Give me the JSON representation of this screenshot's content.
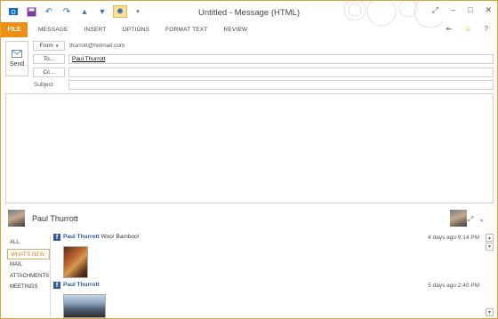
{
  "window": {
    "title": "Untitled - Message (HTML)"
  },
  "qat": {
    "icons": [
      "outlook-icon",
      "save-icon",
      "undo-icon",
      "redo-icon",
      "previous-icon",
      "next-icon",
      "touch-mode-icon",
      "customize-icon"
    ]
  },
  "ribbon": {
    "tabs": [
      "FILE",
      "MESSAGE",
      "INSERT",
      "OPTIONS",
      "FORMAT TEXT",
      "REVIEW"
    ],
    "accent": "#ef8f12"
  },
  "compose": {
    "send_label": "Send",
    "from_label": "From",
    "from_value": "thurrott@hotmail.com",
    "to_label": "To...",
    "to_value": "Paul Thurrott",
    "cc_label": "Cc...",
    "cc_value": "",
    "subject_label": "Subject",
    "subject_value": ""
  },
  "people_pane": {
    "contact_name": "Paul Thurrott",
    "nav": [
      "ALL",
      "WHAT'S NEW",
      "MAIL",
      "ATTACHMENTS",
      "MEETINGS"
    ],
    "selected": "WHAT'S NEW",
    "feed": [
      {
        "author": "Paul Thurrott",
        "message": "Woo! Bamboo!",
        "when": "4 days ago 9:14 PM"
      },
      {
        "author": "Paul Thurrott",
        "message": "",
        "when": "5 days ago 2:40 PM"
      }
    ]
  }
}
